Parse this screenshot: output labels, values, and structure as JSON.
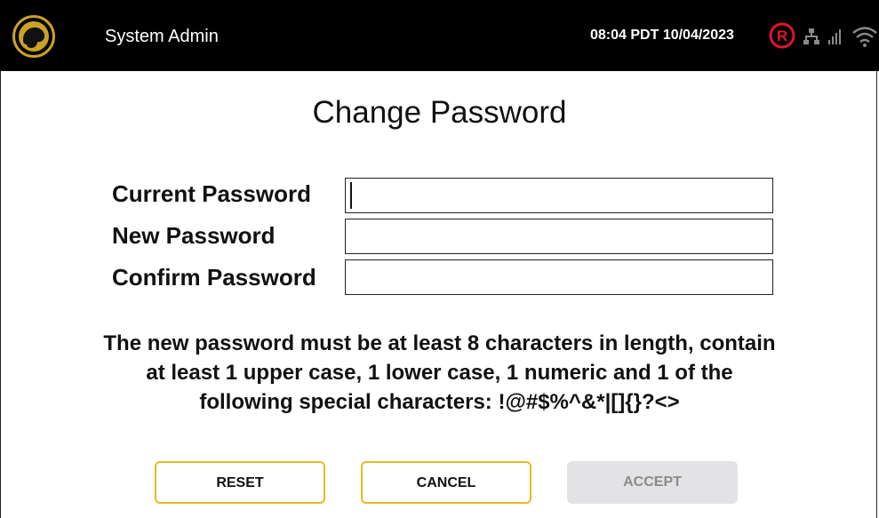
{
  "header": {
    "title": "System Admin",
    "datetime": "08:04 PDT 10/04/2023",
    "icons": [
      "brand-logo-icon",
      "registered-icon",
      "network-icon",
      "signal-icon",
      "wifi-icon"
    ],
    "colors": {
      "bar": "#000000",
      "logo_ring": "#c9a227",
      "status_red": "#e0142b"
    }
  },
  "page": {
    "title": "Change Password"
  },
  "form": {
    "fields": [
      {
        "label": "Current Password",
        "value": ""
      },
      {
        "label": "New Password",
        "value": ""
      },
      {
        "label": "Confirm Password",
        "value": ""
      }
    ],
    "rules": [
      "The new password must be at least 8 characters in length, contain",
      "at least 1 upper case, 1 lower case, 1 numeric and 1 of the",
      "following special characters: !@#$%^&*|[]{}?<>"
    ]
  },
  "buttons": {
    "reset": "RESET",
    "cancel": "CANCEL",
    "accept": "ACCEPT",
    "accent": "#e8b923"
  }
}
